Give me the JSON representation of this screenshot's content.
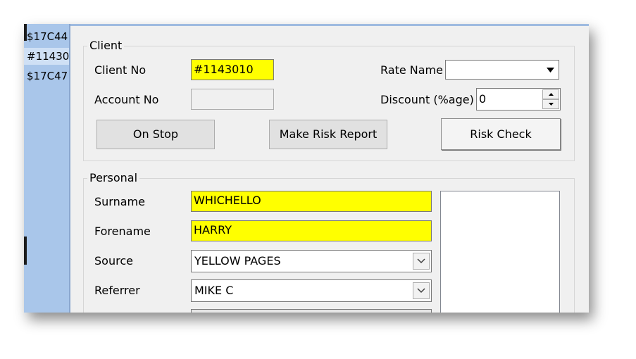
{
  "list_strip": {
    "rows": [
      {
        "text": "$17C44"
      },
      {
        "text": "#11430"
      },
      {
        "text": "$17C47"
      }
    ]
  },
  "client": {
    "group_label": "Client",
    "client_no_label": "Client No",
    "client_no_value": "#1143010",
    "account_no_label": "Account No",
    "account_no_value": "",
    "rate_name_label": "Rate Name",
    "rate_name_value": "",
    "discount_label": "Discount (%age)",
    "discount_value": "0",
    "buttons": {
      "on_stop": "On Stop",
      "make_risk_report": "Make Risk Report",
      "risk_check": "Risk Check"
    }
  },
  "personal": {
    "group_label": "Personal",
    "surname_label": "Surname",
    "surname_value": "WHICHELLO",
    "forename_label": "Forename",
    "forename_value": "HARRY",
    "source_label": "Source",
    "source_value": "YELLOW PAGES",
    "referrer_label": "Referrer",
    "referrer_value": "MIKE C"
  },
  "colors": {
    "highlight": "#ffff00",
    "form_background": "#f0f0f0",
    "list_background": "#a9c6ea"
  }
}
